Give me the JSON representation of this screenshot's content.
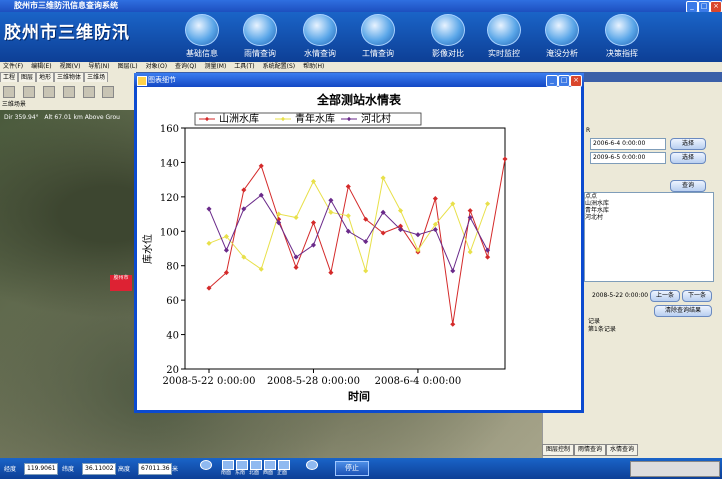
{
  "window": {
    "title": "胶州市三维防汛信息查询系统",
    "min": "_",
    "max": "□",
    "close": "×"
  },
  "app_title": "胶州市三维防汛",
  "nav": [
    {
      "label": "基础信息",
      "icon": "globe-icon"
    },
    {
      "label": "雨情查询",
      "icon": "rain-icon"
    },
    {
      "label": "水情查询",
      "icon": "water-icon"
    },
    {
      "label": "工情查询",
      "icon": "engineering-icon"
    },
    {
      "label": "影像对比",
      "icon": "image-compare-icon"
    },
    {
      "label": "实时监控",
      "icon": "camera-icon"
    },
    {
      "label": "淹没分析",
      "icon": "flood-icon"
    },
    {
      "label": "决策指挥",
      "icon": "command-icon"
    }
  ],
  "menu": [
    "文件(F)",
    "编辑(E)",
    "视图(V)",
    "导航(N)",
    "图层(L)",
    "对象(O)",
    "查询(Q)",
    "测量(M)",
    "工具(T)",
    "系统配置(S)",
    "帮助(H)"
  ],
  "tabs": [
    "工程",
    "图层",
    "地形",
    "三维物体",
    "三维场"
  ],
  "scene_tab": "三维场景",
  "map_hud": {
    "dir": "Dir 359.94°",
    "alt": "Alt 67.01 km Above Grou"
  },
  "map_label": "胶州市",
  "right_panel": {
    "label_r": "R",
    "start_time": "2006-6-4 0:00:00",
    "end_time": "2009-6-5 0:00:00",
    "select1": "选择",
    "select2": "选择",
    "query": "查询",
    "list": [
      "点点",
      "山洲水库",
      "青年水库",
      "河北村"
    ],
    "current_time": "2008-5-22 0:00:00",
    "prev": "上一条",
    "next": "下一条",
    "clear": "清除查询结果",
    "records1": "记录",
    "records2": "第1条记录",
    "tabs": [
      "图层控制",
      "雨情查询",
      "水情查询"
    ]
  },
  "status": {
    "lon_label": "经度",
    "lon": "119.9061",
    "lat_label": "纬度",
    "lat": "36.11002",
    "alt_label": "高度",
    "alt": "67011.36",
    "alt_unit": "米",
    "stop": "停止",
    "icons": [
      "南面",
      "东南",
      "北面",
      "西面",
      "正面"
    ]
  },
  "dialog": {
    "title": "图表细节",
    "min": "_",
    "max": "□",
    "close": "×"
  },
  "colors": {
    "series1": "#d42a2a",
    "series2": "#e8e04a",
    "series3": "#6a2a8a"
  },
  "chart_data": {
    "type": "line",
    "title": "全部测站水情表",
    "xlabel": "时间",
    "ylabel": "库水位",
    "ylim": [
      20,
      160
    ],
    "yticks": [
      20,
      40,
      60,
      80,
      100,
      120,
      140,
      160
    ],
    "xtick_labels": [
      "2008-5-22 0:00:00",
      "2008-5-28 0:00:00",
      "2008-6-4 0:00:00"
    ],
    "xtick_index": [
      0,
      6,
      12
    ],
    "legend": "top",
    "series": [
      {
        "name": "山洲水库",
        "values": [
          67,
          76,
          124,
          138,
          107,
          79,
          105,
          76,
          126,
          107,
          99,
          103,
          88,
          119,
          46,
          112,
          85,
          142
        ]
      },
      {
        "name": "青年水库",
        "values": [
          93,
          97,
          85,
          78,
          110,
          108,
          129,
          111,
          109,
          77,
          131,
          112,
          89,
          104,
          116,
          88,
          116,
          null
        ]
      },
      {
        "name": "河北村",
        "values": [
          113,
          89,
          113,
          121,
          105,
          85,
          92,
          118,
          100,
          94,
          111,
          101,
          98,
          101,
          77,
          108,
          89,
          null
        ]
      }
    ]
  }
}
